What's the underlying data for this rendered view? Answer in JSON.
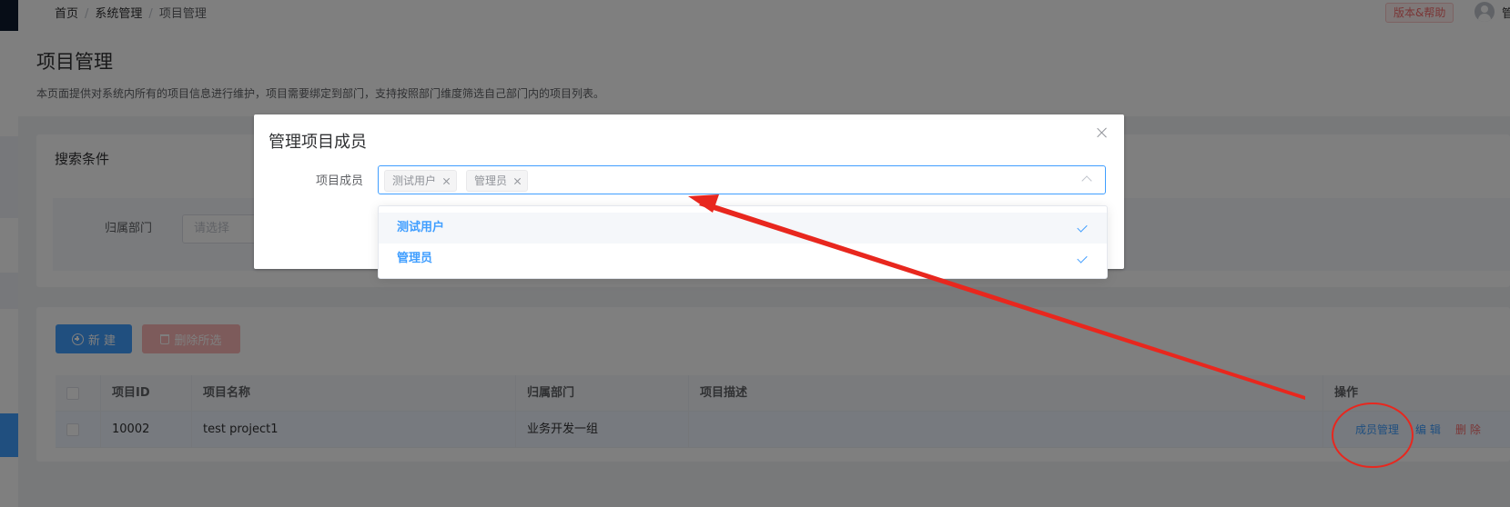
{
  "breadcrumb": {
    "home": "首页",
    "level1": "系统管理",
    "current": "项目管理",
    "separator": "/"
  },
  "header": {
    "help_label": "版本&帮助",
    "user_name": "管理"
  },
  "page": {
    "title": "项目管理",
    "description": "本页面提供对系统内所有的项目信息进行维护，项目需要绑定到部门，支持按照部门维度筛选自己部门内的项目列表。"
  },
  "search": {
    "title": "搜索条件",
    "dept_label": "归属部门",
    "dept_placeholder": "请选择"
  },
  "toolbar": {
    "new_label": "新 建",
    "delete_label": "删除所选"
  },
  "table": {
    "columns": [
      "项目ID",
      "项目名称",
      "归属部门",
      "项目描述",
      "操作"
    ],
    "rows": [
      {
        "id": "10002",
        "name": "test project1",
        "dept": "业务开发一组",
        "desc": ""
      }
    ],
    "actions": {
      "members": "成员管理",
      "edit": "编 辑",
      "delete": "删 除"
    }
  },
  "dialog": {
    "title": "管理项目成员",
    "field_label": "项目成员",
    "selected_tags": [
      "测试用户",
      "管理员"
    ],
    "options": [
      {
        "label": "测试用户",
        "selected": true
      },
      {
        "label": "管理员",
        "selected": true
      }
    ]
  },
  "colors": {
    "primary": "#409eff",
    "danger": "#f56c6c",
    "annotation": "#e8271e"
  }
}
